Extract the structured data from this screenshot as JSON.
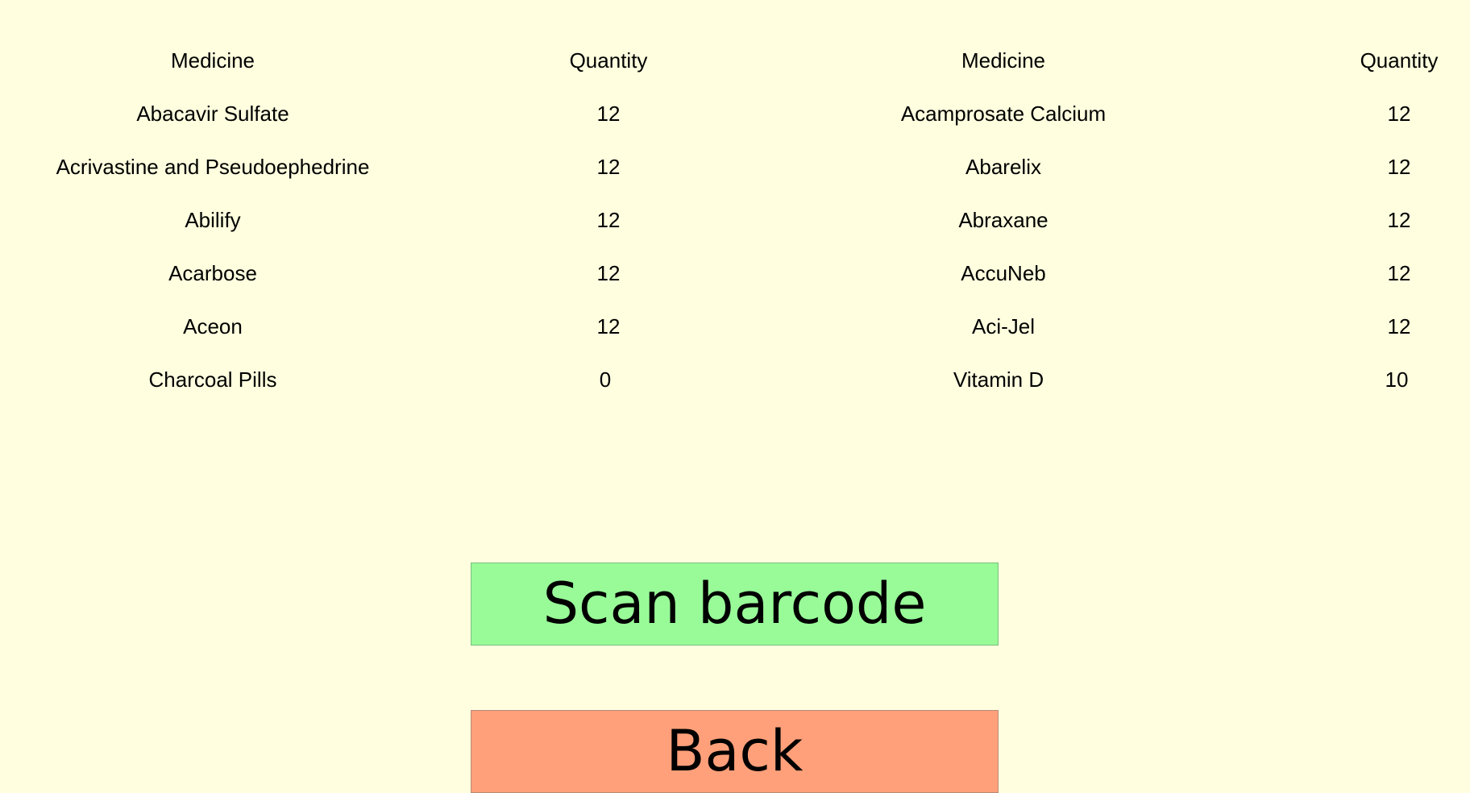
{
  "table": {
    "headers": [
      "Medicine",
      "Quantity",
      "Medicine",
      "Quantity"
    ],
    "rows": [
      [
        "Abacavir Sulfate",
        "12",
        "Acamprosate Calcium",
        "12"
      ],
      [
        "Acrivastine and Pseudoephedrine",
        "12",
        "Abarelix",
        "12"
      ],
      [
        "Abilify",
        "12",
        "Abraxane",
        "12"
      ],
      [
        "Acarbose",
        "12",
        "AccuNeb",
        "12"
      ],
      [
        "Aceon",
        "12",
        "Aci-Jel",
        "12"
      ],
      [
        "Charcoal Pills",
        "0",
        "Vitamin D",
        "10"
      ]
    ]
  },
  "buttons": {
    "scan_label": "Scan barcode",
    "back_label": "Back"
  },
  "colors": {
    "background": "#ffffdf",
    "scan_button": "#98fb98",
    "back_button": "#ffa07a"
  }
}
